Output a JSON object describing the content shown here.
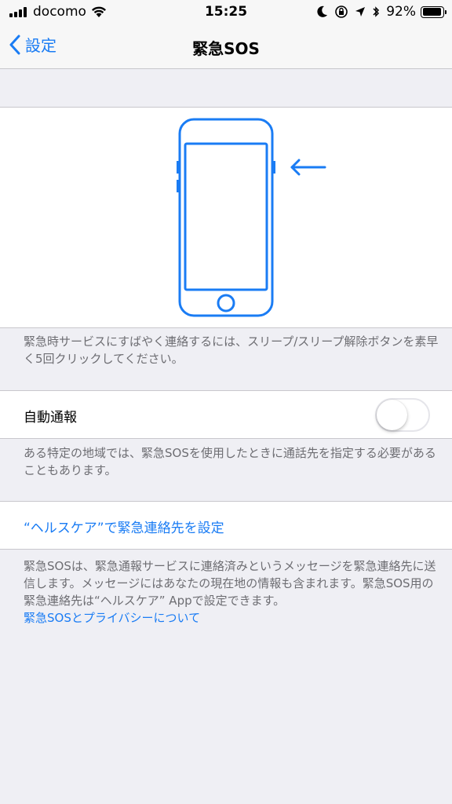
{
  "status_bar": {
    "carrier": "docomo",
    "time": "15:25",
    "battery_percent": "92%",
    "battery_level": 0.92,
    "icons": [
      "signal-icon",
      "wifi-icon",
      "moon-icon",
      "rotation-lock-icon",
      "location-icon",
      "bluetooth-icon",
      "battery-icon"
    ]
  },
  "nav": {
    "back_label": "設定",
    "title": "緊急SOS"
  },
  "illustration": {
    "icon": "phone-side-button-icon",
    "accent_color": "#1a7cf4"
  },
  "section1": {
    "footer": "緊急時サービスにすばやく連絡するには、スリープ/スリープ解除ボタンを素早く5回クリックしてください。"
  },
  "auto_call": {
    "label": "自動通報",
    "toggle_on": false
  },
  "section2": {
    "footer": "ある特定の地域では、緊急SOSを使用したときに通話先を指定する必要があることもあります。"
  },
  "health_link": {
    "label": "“ヘルスケア”で緊急連絡先を設定"
  },
  "section3": {
    "footer": "緊急SOSは、緊急通報サービスに連絡済みというメッセージを緊急連絡先に送信します。メッセージにはあなたの現在地の情報も含まれます。緊急SOS用の緊急連絡先は“ヘルスケア” Appで設定できます。",
    "link": "緊急SOSとプライバシーについて"
  },
  "colors": {
    "accent": "#1a7cf4",
    "background": "#efeff4",
    "footer_text": "#6d6d72"
  }
}
